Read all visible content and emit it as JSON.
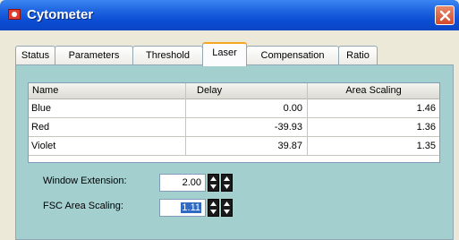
{
  "window": {
    "title": "Cytometer",
    "icon": "cytometer-app-icon",
    "close_icon": "close-icon"
  },
  "tabs": [
    {
      "label": "Status",
      "active": false
    },
    {
      "label": "Parameters",
      "active": false
    },
    {
      "label": "Threshold",
      "active": false
    },
    {
      "label": "Laser",
      "active": true
    },
    {
      "label": "Compensation",
      "active": false
    },
    {
      "label": "Ratio",
      "active": false
    }
  ],
  "laser_table": {
    "columns": [
      "Name",
      "Delay",
      "Area Scaling"
    ],
    "rows": [
      {
        "name": "Blue",
        "delay": "0.00",
        "area_scaling": "1.46"
      },
      {
        "name": "Red",
        "delay": "-39.93",
        "area_scaling": "1.36"
      },
      {
        "name": "Violet",
        "delay": "39.87",
        "area_scaling": "1.35"
      }
    ]
  },
  "fields": {
    "window_extension": {
      "label": "Window Extension:",
      "value": "2.00"
    },
    "fsc_area_scaling": {
      "label": "FSC Area Scaling:",
      "value": "1.11"
    }
  },
  "colors": {
    "titlebar": "#0a4cd3",
    "panel_bg": "#a3cfcf",
    "active_tab_accent": "#f5a623",
    "selection": "#316ac5"
  }
}
